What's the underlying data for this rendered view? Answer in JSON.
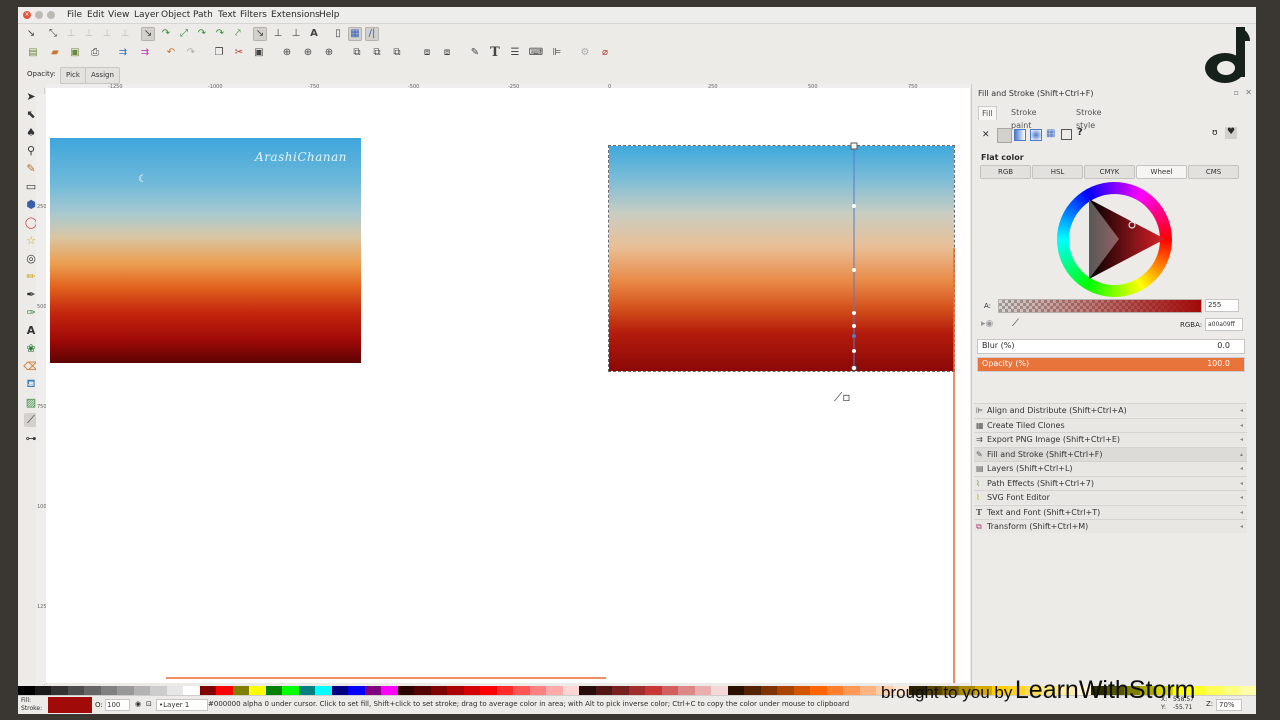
{
  "menubar": {
    "items": [
      "File",
      "Edit",
      "View",
      "Layer",
      "Object",
      "Path",
      "Text",
      "Filters",
      "Extensions",
      "Help"
    ]
  },
  "toolbar_select": {
    "opacity_label": "Opacity:",
    "pick_label": "Pick",
    "assign_label": "Assign"
  },
  "ruler": {
    "h_ticks": [
      "-1250",
      "-1000",
      "-750",
      "-500",
      "-250",
      "0",
      "250",
      "500",
      "750"
    ],
    "v_ticks": [
      "250",
      "500",
      "750",
      "1000",
      "1250"
    ]
  },
  "canvas": {
    "watermark_text": "ArashiChanan"
  },
  "panel": {
    "title": "Fill and Stroke (Shift+Ctrl+F)",
    "tabs": {
      "fill": "Fill",
      "stroke_paint": "Stroke paint",
      "stroke_style": "Stroke style"
    },
    "flat_color_label": "Flat color",
    "modes": [
      "RGB",
      "HSL",
      "CMYK",
      "Wheel",
      "CMS"
    ],
    "alpha_label": "A:",
    "alpha_value": "255",
    "rgba_label": "RGBA:",
    "rgba_value": "a00a09ff",
    "blur_label": "Blur (%)",
    "blur_value": "0.0",
    "opacity_label": "Opacity (%)",
    "opacity_value": "100.0",
    "docked": [
      {
        "label": "Align and Distribute (Shift+Ctrl+A)",
        "icon": "align-icon"
      },
      {
        "label": "Create Tiled Clones",
        "icon": "tiled-clones-icon"
      },
      {
        "label": "Export PNG Image (Shift+Ctrl+E)",
        "icon": "export-icon"
      },
      {
        "label": "Fill and Stroke (Shift+Ctrl+F)",
        "icon": "fill-stroke-icon"
      },
      {
        "label": "Layers (Shift+Ctrl+L)",
        "icon": "layers-icon"
      },
      {
        "label": "Path Effects  (Shift+Ctrl+7)",
        "icon": "path-effects-icon"
      },
      {
        "label": "SVG Font Editor",
        "icon": "font-editor-icon"
      },
      {
        "label": "Text and Font (Shift+Ctrl+T)",
        "icon": "text-font-icon"
      },
      {
        "label": "Transform (Shift+Ctrl+M)",
        "icon": "transform-icon"
      }
    ]
  },
  "status": {
    "fill_label": "Fill:",
    "stroke_label": "Stroke:",
    "opacity_short": "O:",
    "opacity_value": "100",
    "layer_value": "•Layer 1",
    "message": "#000000 alpha 0 under cursor. Click to set fill, Shift+click to set stroke; drag to average color in area; with Alt to pick inverse color; Ctrl+C to copy the color under mouse to clipboard",
    "x_label": "X:",
    "x_value": "558.57",
    "y_label": "Y:",
    "y_value": "-55.71",
    "zoom_label": "Z:",
    "zoom_value": "70%"
  },
  "overlay": {
    "brought_text": "brought to you by",
    "brand_text": "LearnWithStorm"
  },
  "colors": {
    "selected_fill": "#a00a09",
    "accent": "#e8743b",
    "wheel_ring": "hsv"
  }
}
